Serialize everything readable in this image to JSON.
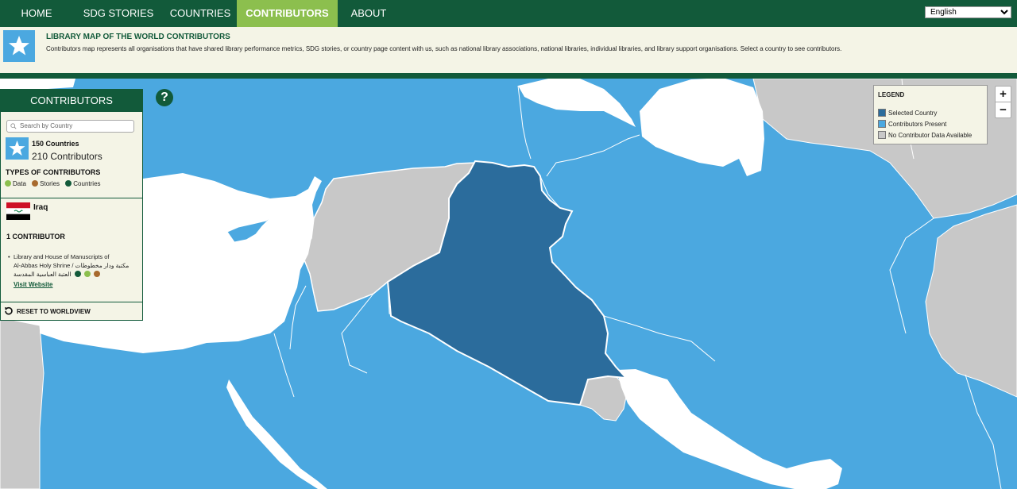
{
  "nav": {
    "items": [
      {
        "label": "HOME",
        "active": false
      },
      {
        "label": "SDG STORIES",
        "active": false
      },
      {
        "label": "COUNTRIES",
        "active": false
      },
      {
        "label": "CONTRIBUTORS",
        "active": true
      },
      {
        "label": "ABOUT",
        "active": false
      }
    ],
    "language": "English"
  },
  "banner": {
    "title": "LIBRARY MAP OF THE WORLD CONTRIBUTORS",
    "description": "Contributors map represents all organisations that have shared library performance metrics, SDG stories, or country page content with us, such as national library associations, national libraries, individual libraries, and library support organisations. Select a country to see contributors."
  },
  "panel": {
    "title": "CONTRIBUTORS",
    "search_placeholder": "Search by Country",
    "countries_count": "150 Countries",
    "contributors_count": "210 Contributors",
    "types_title": "TYPES OF CONTRIBUTORS",
    "types": [
      {
        "label": "Data",
        "color": "#8cbf4e"
      },
      {
        "label": "Stories",
        "color": "#a86a2e"
      },
      {
        "label": "Countries",
        "color": "#125a3a"
      }
    ],
    "selected_country": "Iraq",
    "contributor_count_label": "1 CONTRIBUTOR",
    "contributor": {
      "name_line1": "Library and House of Manuscripts of",
      "name_line2": "Al-Abbas Holy Shrine / مكتبة ودار مخطوطات",
      "name_line3": "العتبة العباسية المقدسة",
      "dot_colors": [
        "#125a3a",
        "#8cbf4e",
        "#a86a2e"
      ],
      "link": "Visit Website"
    },
    "reset_label": "RESET TO WORLDVIEW"
  },
  "help_label": "?",
  "legend": {
    "title": "LEGEND",
    "items": [
      {
        "label": "Selected Country",
        "color": "#2b6c9c"
      },
      {
        "label": "Contributors Present",
        "color": "#4ba8e0"
      },
      {
        "label": "No Contributor Data Available",
        "color": "#c8c8c8"
      }
    ]
  },
  "zoom": {
    "in": "+",
    "out": "−"
  },
  "colors": {
    "brand_green": "#125a3a",
    "accent_green": "#8cbf4e",
    "contributors_present": "#4ba8e0",
    "selected_country": "#2b6c9c",
    "no_data": "#c8c8c8",
    "water": "#ffffff"
  }
}
